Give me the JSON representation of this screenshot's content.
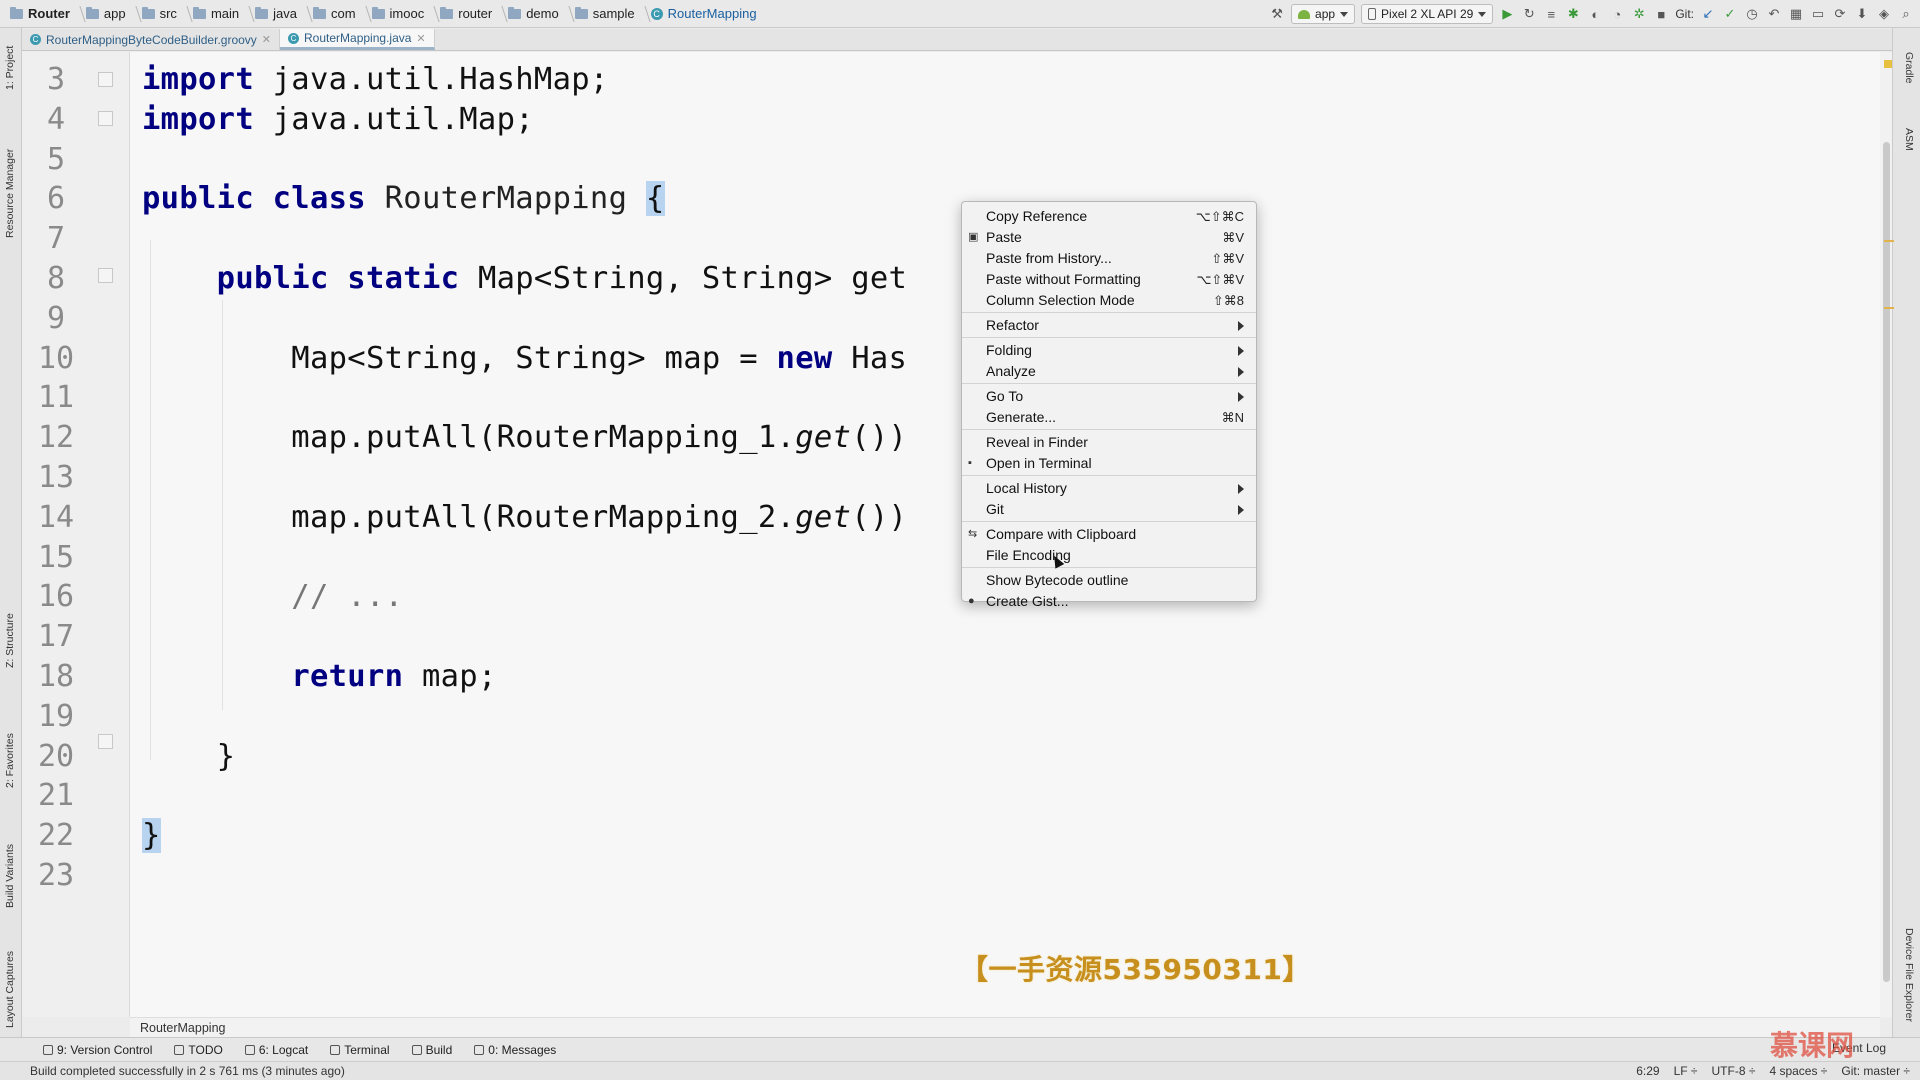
{
  "navbar": {
    "crumbs": [
      "Router",
      "app",
      "src",
      "main",
      "java",
      "com",
      "imooc",
      "router",
      "demo",
      "sample",
      "RouterMapping"
    ],
    "run_config": "app",
    "device": "Pixel 2 XL API 29",
    "git_label": "Git:"
  },
  "tabs": [
    {
      "label": "RouterMappingByteCodeBuilder.groovy"
    },
    {
      "label": "RouterMapping.java"
    }
  ],
  "left_tools": [
    "1: Project",
    "Resource Manager",
    "Z: Structure",
    "2: Favorites",
    "Build Variants",
    "Layout Captures"
  ],
  "right_tools": [
    "Gradle",
    "ASM",
    "Device File Explorer"
  ],
  "editor": {
    "lines": [
      {
        "n": "3",
        "tokens": [
          {
            "t": "import",
            "c": "kw"
          },
          {
            "t": " java.util.HashMap;",
            "c": ""
          }
        ]
      },
      {
        "n": "4",
        "tokens": [
          {
            "t": "import",
            "c": "kw"
          },
          {
            "t": " java.util.Map;",
            "c": ""
          }
        ]
      },
      {
        "n": "5",
        "tokens": []
      },
      {
        "n": "6",
        "tokens": [
          {
            "t": "public class",
            "c": "kw"
          },
          {
            "t": " RouterMapping ",
            "c": "cls"
          },
          {
            "t": "{",
            "c": "brace"
          }
        ]
      },
      {
        "n": "7",
        "tokens": []
      },
      {
        "n": "8",
        "tokens": [
          {
            "t": "    ",
            "c": ""
          },
          {
            "t": "public static",
            "c": "kw"
          },
          {
            "t": " Map<String, String> get",
            "c": ""
          }
        ]
      },
      {
        "n": "9",
        "tokens": []
      },
      {
        "n": "10",
        "tokens": [
          {
            "t": "        Map<String, String> map = ",
            "c": ""
          },
          {
            "t": "new",
            "c": "kw"
          },
          {
            "t": " Has",
            "c": ""
          }
        ]
      },
      {
        "n": "11",
        "tokens": []
      },
      {
        "n": "12",
        "tokens": [
          {
            "t": "        map.putAll(RouterMapping_1.",
            "c": ""
          },
          {
            "t": "get",
            "c": "it"
          },
          {
            "t": "())",
            "c": ""
          }
        ]
      },
      {
        "n": "13",
        "tokens": []
      },
      {
        "n": "14",
        "tokens": [
          {
            "t": "        map.putAll(RouterMapping_2.",
            "c": ""
          },
          {
            "t": "get",
            "c": "it"
          },
          {
            "t": "())",
            "c": ""
          }
        ]
      },
      {
        "n": "15",
        "tokens": []
      },
      {
        "n": "16",
        "tokens": [
          {
            "t": "        // ...",
            "c": "cm"
          }
        ]
      },
      {
        "n": "17",
        "tokens": []
      },
      {
        "n": "18",
        "tokens": [
          {
            "t": "        ",
            "c": ""
          },
          {
            "t": "return",
            "c": "kw"
          },
          {
            "t": " map;",
            "c": ""
          }
        ]
      },
      {
        "n": "19",
        "tokens": []
      },
      {
        "n": "20",
        "tokens": [
          {
            "t": "    }",
            "c": ""
          }
        ]
      },
      {
        "n": "21",
        "tokens": []
      },
      {
        "n": "22",
        "tokens": [
          {
            "t": "}",
            "c": "brace"
          }
        ]
      },
      {
        "n": "23",
        "tokens": []
      }
    ]
  },
  "context_menu": {
    "groups": [
      [
        {
          "label": "Copy Reference",
          "shortcut": "⌥⇧⌘C",
          "submenu": false,
          "icon": ""
        },
        {
          "label": "Paste",
          "shortcut": "⌘V",
          "submenu": false,
          "icon": "clipboard-icon"
        },
        {
          "label": "Paste from History...",
          "shortcut": "⇧⌘V",
          "submenu": false,
          "icon": ""
        },
        {
          "label": "Paste without Formatting",
          "shortcut": "⌥⇧⌘V",
          "submenu": false,
          "icon": ""
        },
        {
          "label": "Column Selection Mode",
          "shortcut": "⇧⌘8",
          "submenu": false,
          "icon": ""
        }
      ],
      [
        {
          "label": "Refactor",
          "shortcut": "",
          "submenu": true,
          "icon": ""
        }
      ],
      [
        {
          "label": "Folding",
          "shortcut": "",
          "submenu": true,
          "icon": ""
        },
        {
          "label": "Analyze",
          "shortcut": "",
          "submenu": true,
          "icon": ""
        }
      ],
      [
        {
          "label": "Go To",
          "shortcut": "",
          "submenu": true,
          "icon": ""
        },
        {
          "label": "Generate...",
          "shortcut": "⌘N",
          "submenu": false,
          "icon": ""
        }
      ],
      [
        {
          "label": "Reveal in Finder",
          "shortcut": "",
          "submenu": false,
          "icon": ""
        },
        {
          "label": "Open in Terminal",
          "shortcut": "",
          "submenu": false,
          "icon": "terminal-icon"
        }
      ],
      [
        {
          "label": "Local History",
          "shortcut": "",
          "submenu": true,
          "icon": ""
        },
        {
          "label": "Git",
          "shortcut": "",
          "submenu": true,
          "icon": ""
        }
      ],
      [
        {
          "label": "Compare with Clipboard",
          "shortcut": "",
          "submenu": false,
          "icon": "compare-icon"
        },
        {
          "label": "File Encoding",
          "shortcut": "",
          "submenu": false,
          "icon": ""
        }
      ],
      [
        {
          "label": "Show Bytecode outline",
          "shortcut": "",
          "submenu": false,
          "icon": ""
        },
        {
          "label": "Create Gist...",
          "shortcut": "",
          "submenu": false,
          "icon": "github-icon"
        }
      ]
    ]
  },
  "watermark": "【一手资源535950311】",
  "breadcrumb_bottom": "RouterMapping",
  "tool_windows": [
    {
      "label": "9: Version Control",
      "icon": "version-control-icon"
    },
    {
      "label": "TODO",
      "icon": "todo-icon"
    },
    {
      "label": "6: Logcat",
      "icon": "logcat-icon"
    },
    {
      "label": "Terminal",
      "icon": "terminal-icon"
    },
    {
      "label": "Build",
      "icon": "build-icon"
    },
    {
      "label": "0: Messages",
      "icon": "messages-icon"
    }
  ],
  "event_log": "Event Log",
  "status": {
    "message": "Build completed successfully in 2 s 761 ms (3 minutes ago)",
    "position": "6:29",
    "line_sep": "LF ÷",
    "encoding": "UTF-8 ÷",
    "indent": "4 spaces ÷",
    "vcs": "Git: master ÷"
  },
  "brand": "慕课网",
  "colors": {
    "keyword": "#000080",
    "caret_line": "#f3f0d8",
    "brace_highlight": "#b7d3ef",
    "watermark": "#c78f1e"
  }
}
